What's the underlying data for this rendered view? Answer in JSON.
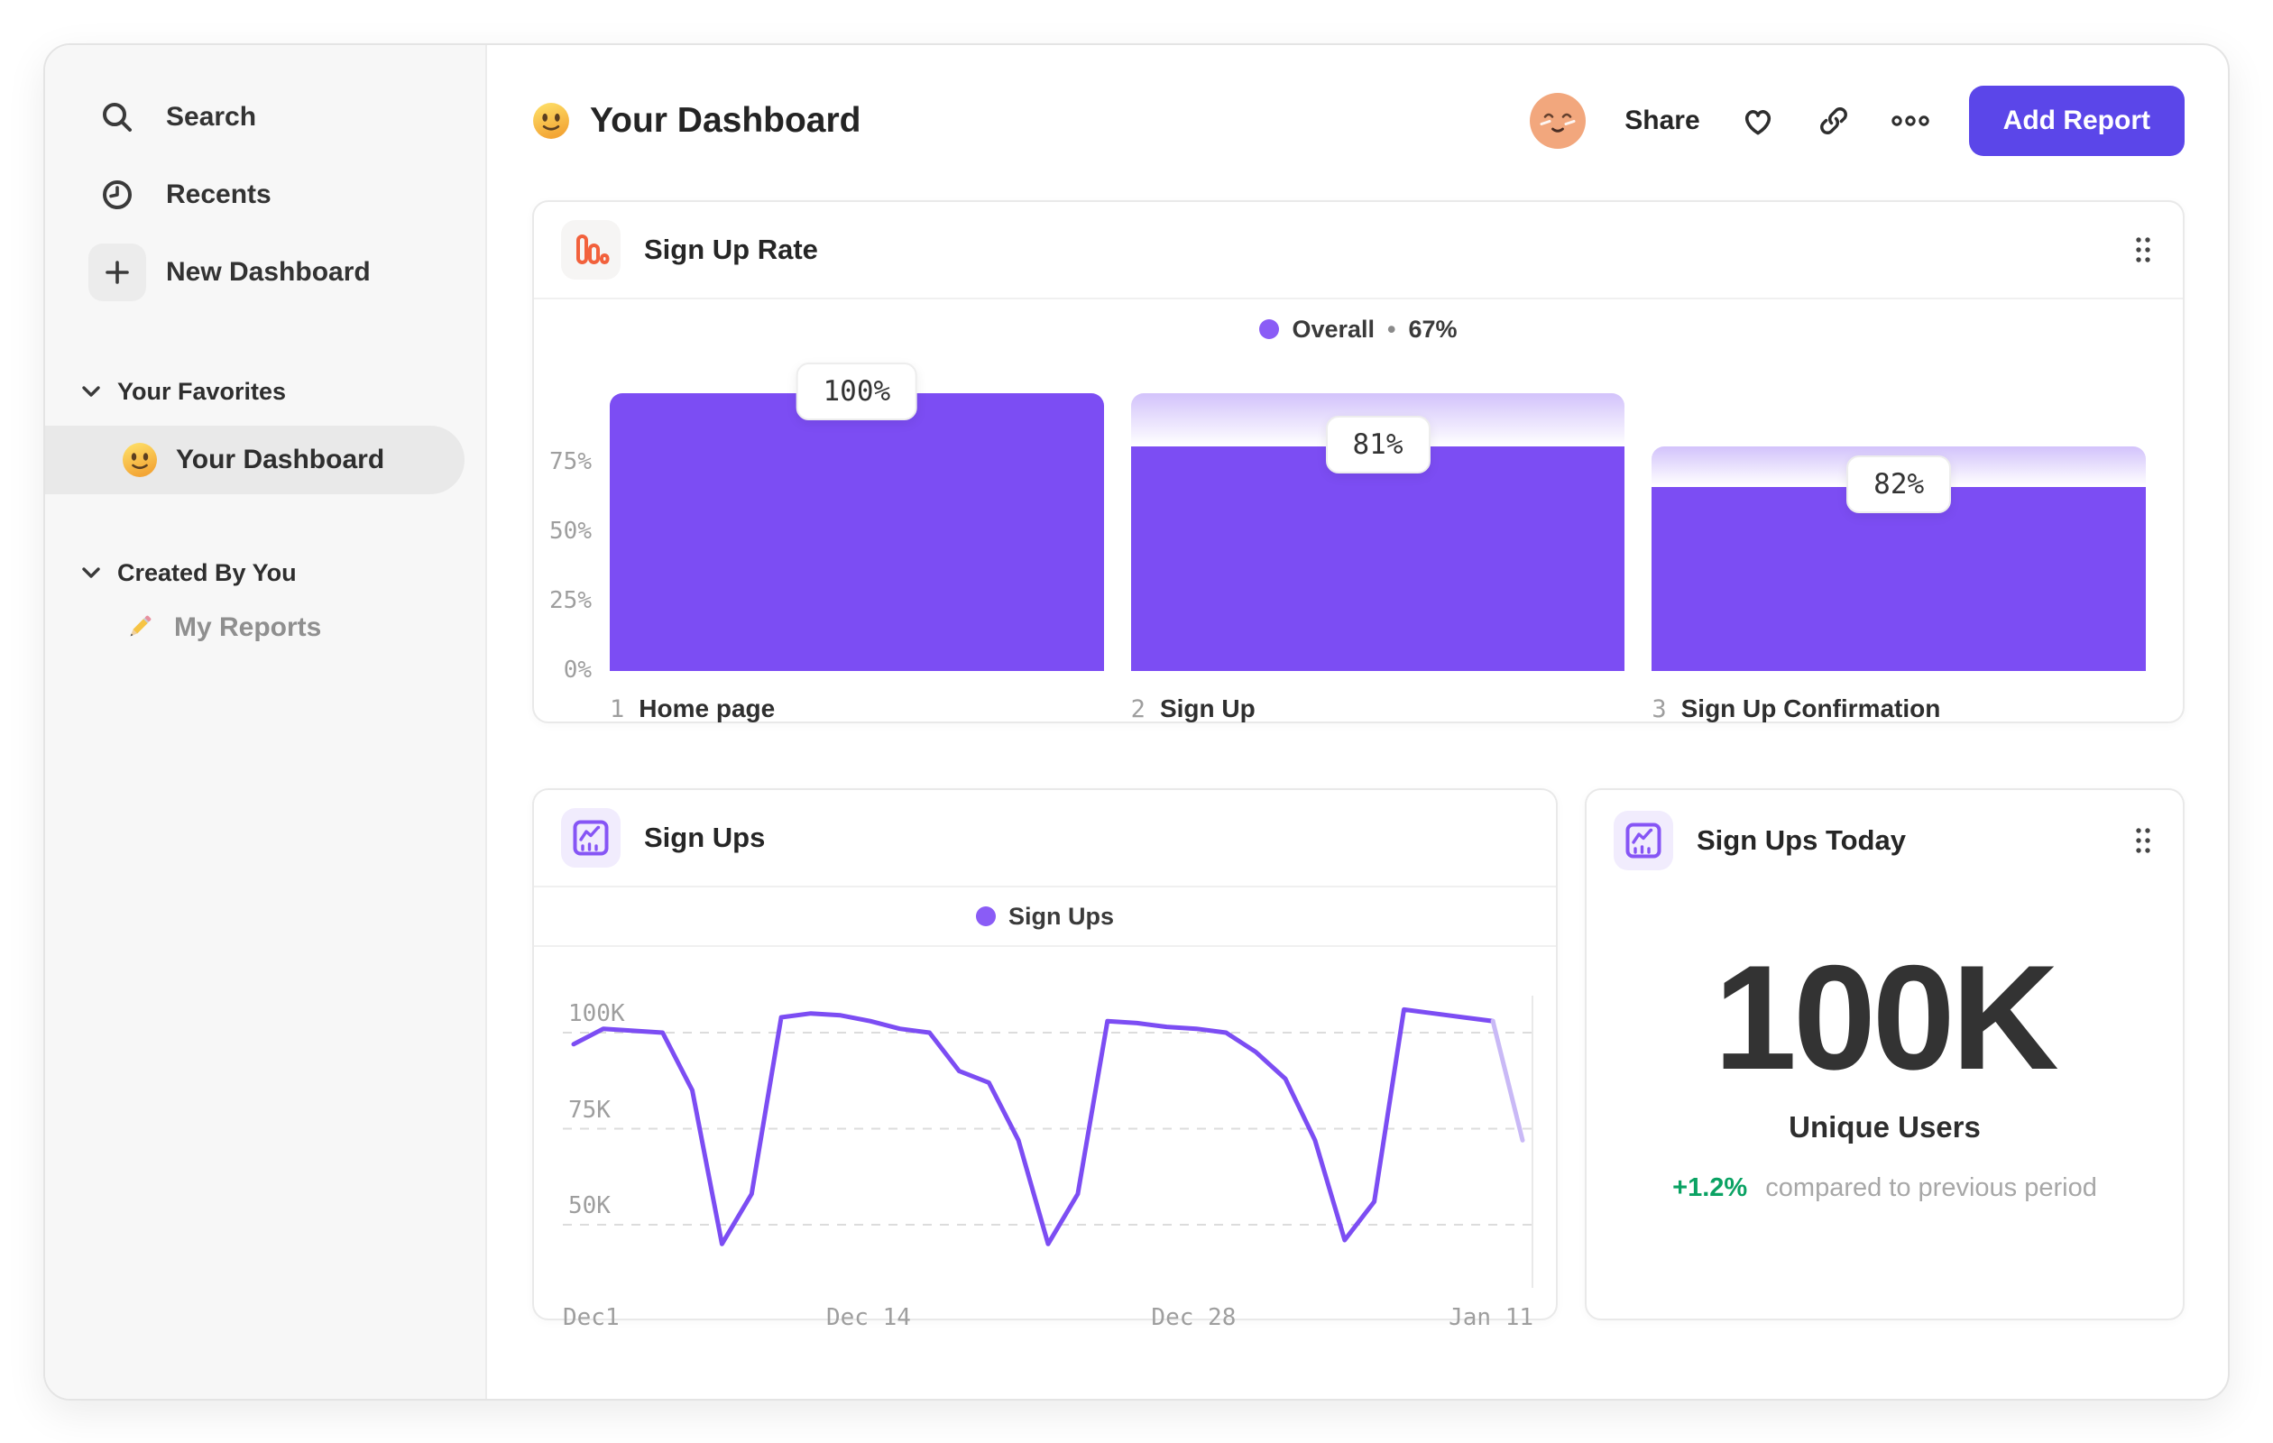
{
  "sidebar": {
    "top_items": [
      {
        "label": "Search"
      },
      {
        "label": "Recents"
      },
      {
        "label": "New Dashboard"
      }
    ],
    "sections": [
      {
        "label": "Your Favorites",
        "items": [
          {
            "label": "Your Dashboard",
            "selected": true
          }
        ]
      },
      {
        "label": "Created By You",
        "items": [
          {
            "label": "My Reports",
            "selected": false
          }
        ]
      }
    ]
  },
  "header": {
    "title": "Your Dashboard",
    "share_label": "Share",
    "add_report_label": "Add Report"
  },
  "signup_rate_card": {
    "title": "Sign Up Rate",
    "legend_label": "Overall",
    "legend_sep": "•",
    "legend_value": "67%"
  },
  "signups_card": {
    "title": "Sign Ups",
    "legend_label": "Sign Ups"
  },
  "signups_today_card": {
    "title": "Sign Ups Today",
    "value": "100K",
    "caption": "Unique Users",
    "delta": "+1.2%",
    "delta_caption": "compared to previous period"
  },
  "colors": {
    "purple": "#7C4DF3",
    "purple_light_tail": "#C9B9F6",
    "legend_dot": "#8A5CF6",
    "accent_button": "#5B46E9",
    "orange": "#F2613C",
    "green": "#0AA263"
  },
  "chart_data": [
    {
      "type": "bar",
      "subtype": "funnel",
      "title": "Sign Up Rate",
      "legend": "Overall • 67%",
      "legend_position": "top-center",
      "categories": [
        "Home page",
        "Sign Up",
        "Sign Up Confirmation"
      ],
      "step_index": [
        1,
        2,
        3
      ],
      "bar_labels": [
        "100%",
        "81%",
        "82%"
      ],
      "conversion_from_previous_pct": [
        100,
        81,
        82
      ],
      "overall_pct": [
        100,
        81,
        66.4
      ],
      "y_ticks": [
        "0%",
        "25%",
        "50%",
        "75%"
      ],
      "ylim": [
        0,
        110
      ],
      "grid": false
    },
    {
      "type": "line",
      "title": "Sign Ups",
      "legend_position": "top-center",
      "series": [
        {
          "name": "Sign Ups",
          "values_thousands": [
            97,
            101,
            100.5,
            100,
            85,
            45,
            58,
            104,
            105,
            104.5,
            103,
            101,
            100,
            90,
            87,
            72,
            45,
            58,
            103,
            102.5,
            101.5,
            101,
            100,
            95,
            88,
            72,
            46,
            56,
            106,
            105,
            104,
            103,
            72
          ]
        }
      ],
      "incomplete_tail_points": 1,
      "x_ticks": [
        "Dec1",
        "Dec 14",
        "Dec 28",
        "Jan 11"
      ],
      "x_tick_fractions": [
        0,
        0.315,
        0.65,
        1
      ],
      "y_ticks": [
        {
          "label": "100K",
          "value": 100
        },
        {
          "label": "75K",
          "value": 75
        },
        {
          "label": "50K",
          "value": 50
        }
      ],
      "ylim_thousands": [
        40,
        110
      ],
      "grid": "dashed-horizontal"
    }
  ]
}
